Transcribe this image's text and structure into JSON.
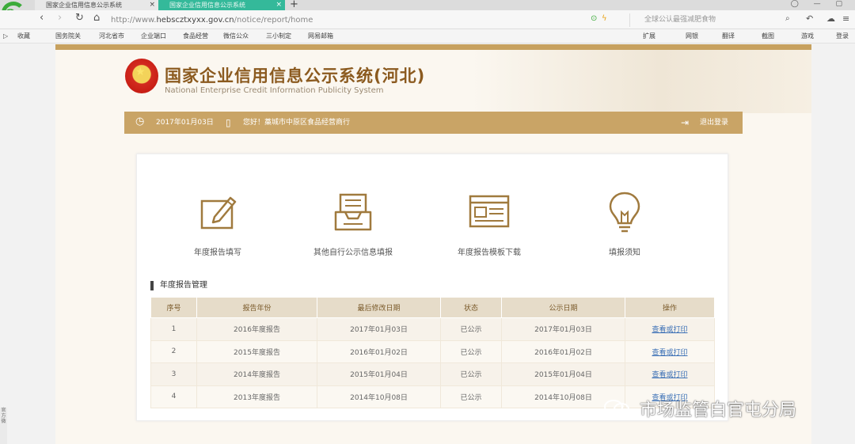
{
  "browser": {
    "tabs": [
      {
        "label": "国家企业信用信息公示系统",
        "close": "×"
      },
      {
        "label": "国家企业信用信息公示系统",
        "close": "×"
      }
    ],
    "new_tab": "+",
    "window_controls": "◯ — ▢",
    "url_prefix": "http://www.",
    "url_domain": "hebscztxyxx.gov.cn",
    "url_path": "/notice/report/home",
    "search_placeholder": "全球公认最强减肥食物",
    "bookmarks": [
      "收藏",
      "国务院关",
      "河北省市",
      "企业端口",
      "食品经营",
      "微信公众",
      "三小制定",
      "网易邮箱"
    ],
    "bookmarks_right": [
      "扩展",
      "网银",
      "翻译",
      "截图",
      "游戏",
      "登录"
    ]
  },
  "header": {
    "title_cn": "国家企业信用信息公示系统(河北)",
    "title_en": "National Enterprise Credit Information Publicity System"
  },
  "infobar": {
    "date": "2017年01月03日",
    "greeting": "您好！藁城市中原区食品经营商行",
    "logout": "退出登录"
  },
  "features": [
    {
      "label": "年度报告填写",
      "icon": "edit-report-icon"
    },
    {
      "label": "其他自行公示信息填报",
      "icon": "inbox-tray-icon"
    },
    {
      "label": "年度报告模板下载",
      "icon": "template-download-icon"
    },
    {
      "label": "填报须知",
      "icon": "lightbulb-icon"
    }
  ],
  "section_title": "年度报告管理",
  "table": {
    "headers": [
      "序号",
      "报告年份",
      "最后修改日期",
      "状态",
      "公示日期",
      "操作"
    ],
    "rows": [
      [
        "1",
        "2016年度报告",
        "2017年01月03日",
        "已公示",
        "2017年01月03日",
        "查看或打印"
      ],
      [
        "2",
        "2015年度报告",
        "2016年01月02日",
        "已公示",
        "2016年01月02日",
        "查看或打印"
      ],
      [
        "3",
        "2014年度报告",
        "2015年01月04日",
        "已公示",
        "2015年01月04日",
        "查看或打印"
      ],
      [
        "4",
        "2013年度报告",
        "2014年10月08日",
        "已公示",
        "2014年10月08日",
        "查看或打印"
      ]
    ]
  },
  "watermark": "市场监管白官屯分局",
  "side_text": "官方微"
}
